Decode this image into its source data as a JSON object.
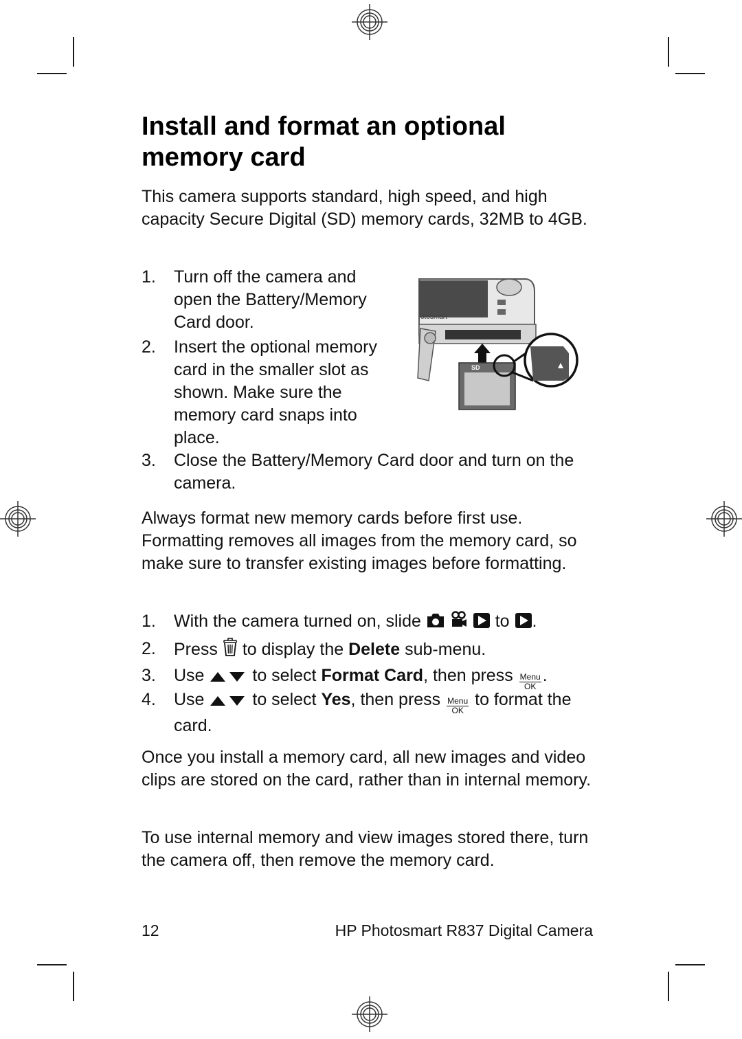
{
  "page": {
    "title_line1": "Install and format an optional",
    "title_line2": "memory card",
    "intro": "This camera supports standard, high speed, and high capacity Secure Digital (SD) memory cards, 32MB to 4GB.",
    "install_steps": [
      {
        "num": "1.",
        "lines": [
          "Turn off the camera and",
          "open the Battery/Memory",
          "Card door."
        ]
      },
      {
        "num": "2.",
        "lines": [
          "Insert the optional memory",
          "card in the smaller slot as",
          "shown. Make sure the",
          "memory card snaps into",
          "place."
        ]
      },
      {
        "num": "3.",
        "lines": [
          "Close the Battery/Memory Card door and turn on the",
          "camera."
        ]
      }
    ],
    "format_note": "Always format new memory cards before first use. Formatting removes all images from the memory card, so make sure to transfer existing images before formatting.",
    "format_steps": {
      "s1": {
        "num": "1.",
        "pre": "With the camera turned on, slide",
        "mid": "to",
        "post": "."
      },
      "s2": {
        "num": "2.",
        "pre": "Press",
        "mid": "to display the",
        "bold": "Delete",
        "post": "sub-menu."
      },
      "s3": {
        "num": "3.",
        "pre": "Use",
        "mid": "to select",
        "bold": "Format Card",
        "post": ", then press",
        "end": "."
      },
      "s4": {
        "num": "4.",
        "pre": "Use",
        "mid": "to select",
        "bold": "Yes",
        "post": ", then press",
        "end": "to format the",
        "line2": "card."
      }
    },
    "menu_ok": {
      "top": "Menu",
      "bottom": "OK"
    },
    "after_install": "Once you install a memory card, all new images and video clips are stored on the card, rather than in internal memory.",
    "internal_memory": "To use internal memory and view images stored there, turn the camera off, then remove the memory card.",
    "illustration": {
      "brand_text": "otosmart",
      "card_label": "SD"
    }
  },
  "footer": {
    "page_number": "12",
    "product": "HP Photosmart R837 Digital Camera"
  },
  "icons": [
    "registration-mark",
    "crop-mark",
    "camera-icon",
    "video-icon",
    "playback-icon",
    "trash-icon",
    "up-down-arrows-icon",
    "menu-ok-icon"
  ]
}
